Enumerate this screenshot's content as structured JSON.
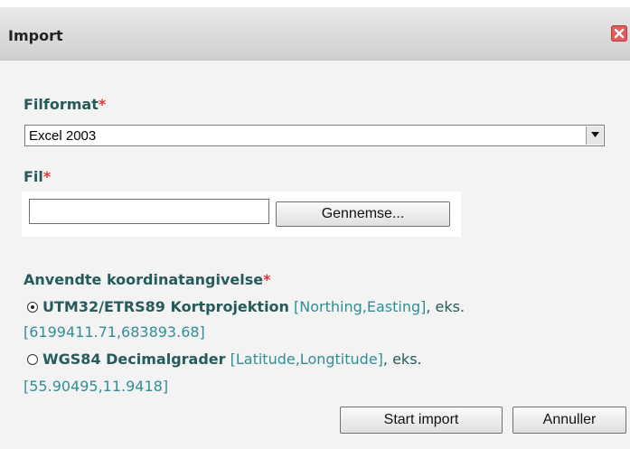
{
  "dialog": {
    "title": "Import",
    "close_icon": "close-icon"
  },
  "fields": {
    "required_marker": "*",
    "file_format": {
      "label": "Filformat",
      "selected": "Excel 2003"
    },
    "file": {
      "label": "Fil",
      "value": "",
      "browse_label": "Gennemse..."
    },
    "coordinates": {
      "label": "Anvendte koordinatangivelse",
      "options": [
        {
          "name": "UTM32/ETRS89 Kortprojektion",
          "hint": "[Northing,Easting]",
          "eg": ", eks.",
          "example": "[6199411.71,683893.68]",
          "checked": true
        },
        {
          "name": "WGS84 Decimalgrader",
          "hint": "[Latitude,Longtitude]",
          "eg": ", eks.",
          "example": "[55.90495,11.9418]",
          "checked": false
        }
      ]
    }
  },
  "actions": {
    "start_label": "Start import",
    "cancel_label": "Annuller"
  },
  "colors": {
    "label": "#275a5a",
    "hint": "#2f8f97",
    "required": "#e23535",
    "close": "#e35b5b"
  }
}
